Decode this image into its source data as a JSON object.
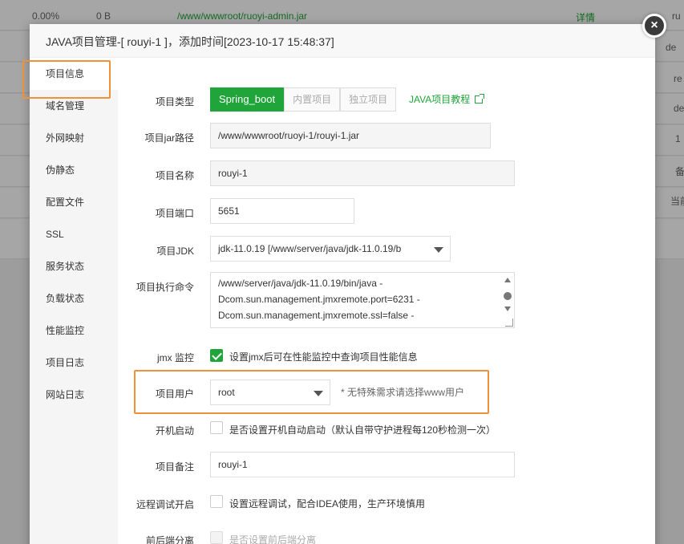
{
  "background": {
    "row1": {
      "percent": "0.00%",
      "size": "0 B",
      "path": "/www/wwwroot/ruoyi-admin.jar",
      "action": "详情",
      "right": "ru"
    },
    "right_col": [
      "de",
      "re",
      "de",
      "1",
      "备",
      "当前"
    ]
  },
  "dialog": {
    "title": "JAVA项目管理-[ rouyi-1 ]，添加时间[2023-10-17 15:48:37]",
    "close_symbol": "×"
  },
  "sidebar": {
    "items": [
      "项目信息",
      "域名管理",
      "外网映射",
      "伪静态",
      "配置文件",
      "SSL",
      "服务状态",
      "负载状态",
      "性能监控",
      "项目日志",
      "网站日志"
    ]
  },
  "form": {
    "type": {
      "label": "项目类型",
      "options": [
        "Spring_boot",
        "内置项目",
        "独立项目"
      ],
      "tutorial": "JAVA项目教程"
    },
    "jar_path": {
      "label": "项目jar路径",
      "value": "/www/wwwroot/ruoyi-1/rouyi-1.jar"
    },
    "name": {
      "label": "项目名称",
      "value": "rouyi-1"
    },
    "port": {
      "label": "项目端口",
      "value": "5651"
    },
    "jdk": {
      "label": "项目JDK",
      "value": "jdk-11.0.19 [/www/server/java/jdk-11.0.19/b"
    },
    "command": {
      "label": "项目执行命令",
      "lines": [
        "/www/server/java/jdk-11.0.19/bin/java -",
        "Dcom.sun.management.jmxremote.port=6231 -",
        "Dcom.sun.management.jmxremote.ssl=false -"
      ]
    },
    "jmx": {
      "label": "jmx 监控",
      "text": "设置jmx后可在性能监控中查询项目性能信息"
    },
    "user": {
      "label": "项目用户",
      "value": "root",
      "hint": "* 无特殊需求请选择www用户"
    },
    "autostart": {
      "label": "开机启动",
      "text": "是否设置开机自动启动（默认自带守护进程每120秒检测一次）"
    },
    "remark": {
      "label": "项目备注",
      "value": "rouyi-1"
    },
    "remote_debug": {
      "label": "远程调试开启",
      "text": "设置远程调试，配合IDEA使用，生产环境慎用"
    },
    "separation": {
      "label": "前后端分离",
      "text": "是否设置前后端分离"
    }
  },
  "colors": {
    "accent": "#20a53a",
    "highlight": "#f0913a"
  }
}
